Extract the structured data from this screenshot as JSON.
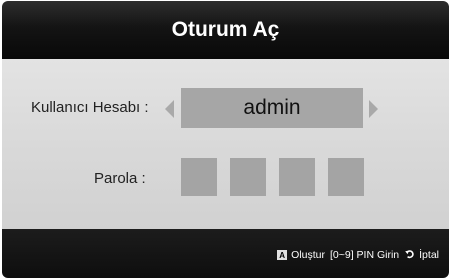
{
  "dialog": {
    "title": "Oturum Aç"
  },
  "form": {
    "username_label": "Kullanıcı Hesabı :",
    "username_value": "admin",
    "password_label": "Parola :",
    "pin_box_count": 4
  },
  "footer": {
    "key_a_label": "A",
    "create_label": "Oluştur",
    "pin_hint": "[0~9] PIN Girin",
    "cancel_label": "İptal",
    "cancel_icon": "return-icon"
  },
  "colors": {
    "title_bar": "#141414",
    "body_bg": "#d9d9d9",
    "field_bg": "#a6a6a6",
    "arrow": "#a9a9a9",
    "footer_bg": "#111111"
  }
}
